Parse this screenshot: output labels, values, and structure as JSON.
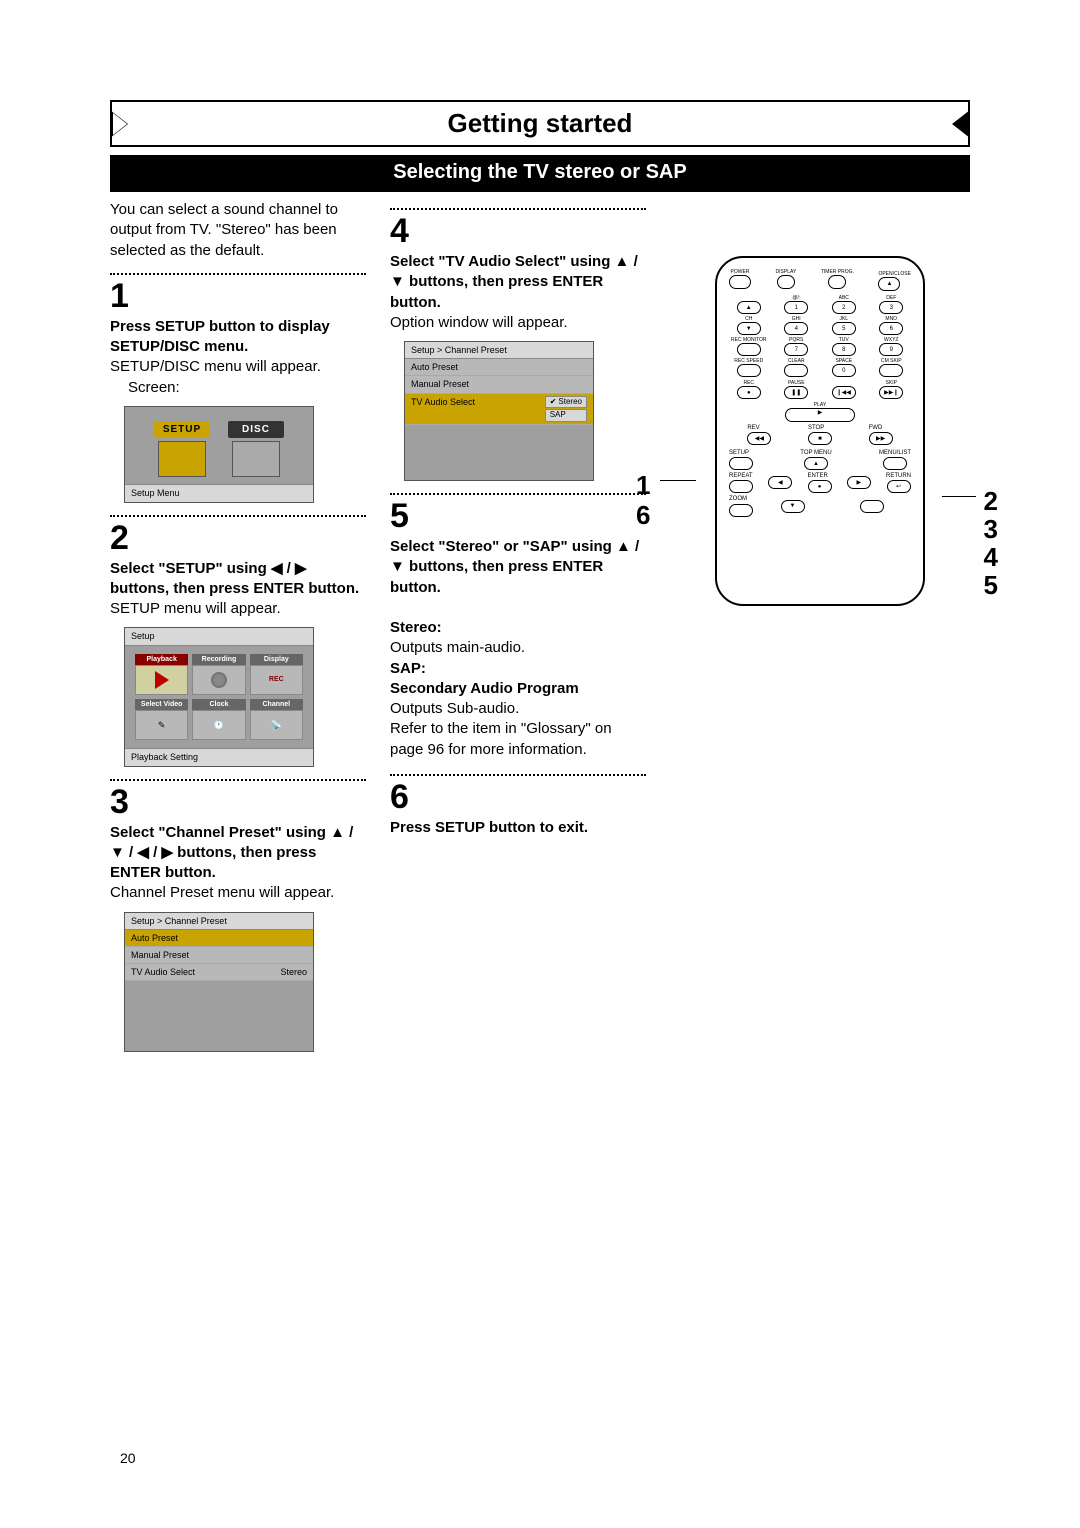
{
  "header": {
    "title": "Getting started",
    "subtitle": "Selecting the TV stereo or SAP"
  },
  "intro": "You can select a sound channel to output from TV.  \"Stereo\" has been selected as the default.",
  "steps": {
    "s1": {
      "num": "1",
      "bold": "Press SETUP button to display SETUP/DISC menu.",
      "body": "SETUP/DISC menu will appear.",
      "indent": "Screen:"
    },
    "s2": {
      "num": "2",
      "bold_a": "Select \"SETUP\" using ",
      "bold_b": " buttons, then press ENTER button.",
      "body": "SETUP menu will appear."
    },
    "s3": {
      "num": "3",
      "bold_a": "Select \"Channel Preset\" using ",
      "bold_b": " buttons, then press ENTER button.",
      "body": "Channel Preset menu will appear."
    },
    "s4": {
      "num": "4",
      "bold_a": "Select \"TV Audio Select\" using ",
      "bold_b": " buttons, then press ENTER button.",
      "body": "Option window will appear."
    },
    "s5": {
      "num": "5",
      "bold_a": "Select \"Stereo\" or \"SAP\" using ",
      "bold_b": " buttons, then press ENTER button.",
      "stereo_h": "Stereo:",
      "stereo_b": "Outputs main-audio.",
      "sap_h1": "SAP:",
      "sap_h2": "Secondary Audio Program",
      "sap_b": "Outputs Sub-audio.",
      "ref": "Refer to the item in \"Glossary\" on page 96 for more information."
    },
    "s6": {
      "num": "6",
      "bold": "Press SETUP button to exit."
    }
  },
  "screen1": {
    "tab1": "SETUP",
    "tab2": "DISC",
    "footer": "Setup Menu"
  },
  "screen2": {
    "head": "Setup",
    "c1": "Playback",
    "c2": "Recording",
    "c3": "Display",
    "c4": "Select Video",
    "c5": "Clock",
    "c6": "Channel",
    "footer": "Playback Setting"
  },
  "screen3": {
    "head": "Setup > Channel Preset",
    "r1": "Auto Preset",
    "r2": "Manual Preset",
    "r3": "TV Audio Select",
    "r3v": "Stereo"
  },
  "screen4": {
    "head": "Setup > Channel Preset",
    "r1": "Auto Preset",
    "r2": "Manual Preset",
    "r3": "TV Audio Select",
    "opt1": "Stereo",
    "opt2": "SAP"
  },
  "remote": {
    "power": "POWER",
    "open": "OPEN/CLOSE",
    "display": "DISPLAY",
    "timer": "TIMER PROG.",
    "at": "@/:",
    "abc": "ABC",
    "def": "DEF",
    "ch": "CH",
    "ghi": "GHI",
    "jkl": "JKL",
    "mno": "MNO",
    "recmon": "REC MONITOR",
    "pqrs": "PQRS",
    "tuv": "TUV",
    "wxyz": "WXYZ",
    "recspeed": "REC SPEED",
    "clear": "CLEAR",
    "space": "SPACE",
    "cmskip": "CM SKIP",
    "rec": "REC",
    "pause": "PAUSE",
    "skip": "SKIP",
    "play": "PLAY",
    "rev": "REV",
    "fwd": "FWD",
    "stop": "STOP",
    "setup": "SETUP",
    "topmenu": "TOP MENU",
    "menulist": "MENU/LIST",
    "repeat": "REPEAT",
    "enter": "ENTER",
    "return": "RETURN",
    "zoom": "ZOOM",
    "n1": "1",
    "n2": "2",
    "n3": "3",
    "n4": "4",
    "n5": "5",
    "n6": "6",
    "n7": "7",
    "n8": "8",
    "n9": "9",
    "n0": "0"
  },
  "callouts": {
    "c1": "1",
    "c6": "6",
    "c2": "2",
    "c3": "3",
    "c4": "4",
    "c5": "5"
  },
  "page": "20"
}
